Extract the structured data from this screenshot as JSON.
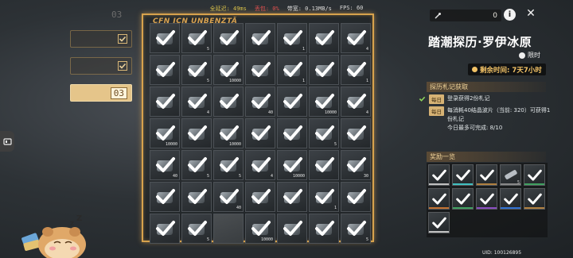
{
  "topbar": {
    "ping": "全延迟: 49ms",
    "warn": "丢包: 0%",
    "net": "带宽: 0.13MB/s",
    "fps": "FPS: 60"
  },
  "left_panel": {
    "page_counter": "03",
    "rows": [
      {
        "label": "",
        "done": true
      },
      {
        "label": "",
        "done": true
      },
      {
        "label": "",
        "number": "03",
        "active": true
      }
    ]
  },
  "board": {
    "title": "CFN ICN UNBENZTÄ",
    "cells": [
      "",
      "5",
      "",
      "",
      "1",
      "",
      "4",
      "",
      "5",
      "10000",
      "",
      "1",
      "",
      "1",
      "",
      "4",
      "",
      "40",
      "",
      "10000",
      "4",
      "10000",
      "",
      "10000",
      "",
      "",
      "5",
      "",
      "40",
      "5",
      "5",
      "4",
      "10000",
      "",
      "30",
      "",
      "",
      "40",
      "",
      "",
      "1",
      "",
      "",
      "5",
      null,
      "10000",
      "",
      "",
      "5"
    ]
  },
  "header": {
    "currency_value": "0",
    "info_icon": "info-icon",
    "close_icon": "close-icon"
  },
  "event": {
    "title": "踏潮探历·罗伊冰原",
    "limited_label": "限时",
    "timer_label": "剩余时间:",
    "timer_value": "7天7小时"
  },
  "tasks": {
    "section_title": "探历札记获取",
    "items": [
      {
        "badge": "每日",
        "text": "登录获得2份札记",
        "done": true
      },
      {
        "badge": "每日",
        "text": "每消耗40结晶波片（当前: 320）可获得1份札记",
        "extra": "今日最多可完成: 8/10",
        "done": false
      }
    ]
  },
  "rewards": {
    "section_title": "奖励一览",
    "cells": [
      {
        "qty": "",
        "bar": "#c0c0c0"
      },
      {
        "qty": "",
        "bar": "#40c0c0"
      },
      {
        "qty": "",
        "bar": "#b08040"
      },
      {
        "qty": "5",
        "bar": "#888888",
        "tool": true
      },
      {
        "qty": "",
        "bar": "#40a060"
      },
      {
        "qty": "",
        "bar": "#c07030"
      },
      {
        "qty": "",
        "bar": "#40a060"
      },
      {
        "qty": "",
        "bar": "#8a4cc0"
      },
      {
        "qty": "",
        "bar": "#3070d0"
      },
      {
        "qty": "",
        "bar": "#b08040"
      },
      {
        "qty": "",
        "bar": "#c0c0c0"
      }
    ]
  },
  "footer": {
    "uid": "UID: 100126895"
  },
  "colors": {
    "board_border": "#d7a24d",
    "accent_gold": "#f2c266",
    "check_green": "#8bd35b"
  }
}
